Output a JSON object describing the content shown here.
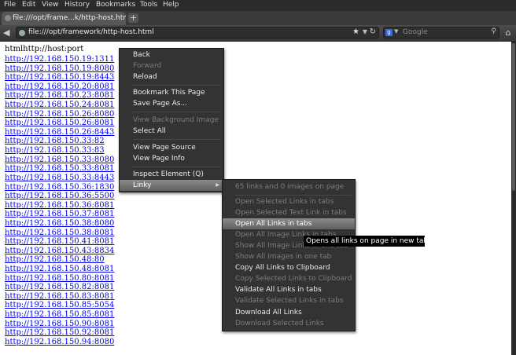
{
  "menubar": [
    "File",
    "Edit",
    "View",
    "History",
    "Bookmarks",
    "Tools",
    "Help"
  ],
  "tab": {
    "title": "file:///opt/frame...k/http-host.html",
    "new_tab": "+"
  },
  "nav": {
    "url": "file:///opt/framework/http-host.html",
    "search_placeholder": "Google",
    "star": "★",
    "reload": "↻",
    "back": "◀",
    "home": "⌂",
    "search_icon": "⚲",
    "google": "g"
  },
  "page": {
    "heading": "htmlhttp://host:port",
    "links": [
      "http://192.168.150.19:1311",
      "http://192.168.150.19:8080",
      "http://192.168.150.19:8443",
      "http://192.168.150.20:8081",
      "http://192.168.150.23:8081",
      "http://192.168.150.24:8081",
      "http://192.168.150.26:8080",
      "http://192.168.150.26:8081",
      "http://192.168.150.26:8443",
      "http://192.168.150.33:82",
      "http://192.168.150.33:83",
      "http://192.168.150.33:8080",
      "http://192.168.150.33:8081",
      "http://192.168.150.33:8443",
      "http://192.168.150.36:1830",
      "http://192.168.150.36:5500",
      "http://192.168.150.36:8081",
      "http://192.168.150.37:8081",
      "http://192.168.150.38:8080",
      "http://192.168.150.38:8081",
      "http://192.168.150.41:8081",
      "http://192.168.150.43:8834",
      "http://192.168.150.48:80",
      "http://192.168.150.48:8081",
      "http://192.168.150.80:8081",
      "http://192.168.150.82:8081",
      "http://192.168.150.83:8081",
      "http://192.168.150.85:5054",
      "http://192.168.150.85:8081",
      "http://192.168.150.90:8081",
      "http://192.168.150.92:8081",
      "http://192.168.150.94:8080"
    ]
  },
  "context_menu": {
    "back": "Back",
    "forward": "Forward",
    "reload": "Reload",
    "bookmark": "Bookmark This Page",
    "save": "Save Page As...",
    "view_bg": "View Background Image",
    "select_all": "Select All",
    "view_source": "View Page Source",
    "view_info": "View Page Info",
    "inspect": "Inspect Element (Q)",
    "linky": "Linky",
    "arrow": "▶"
  },
  "submenu": {
    "summary": "65 links and 0 images on page",
    "open_selected": "Open Selected Links in tabs",
    "open_selected_text": "Open Selected Text Link in tabs",
    "open_all": "Open All Links in tabs",
    "open_all_images": "Open All Image Links in tabs",
    "show_all_image_links": "Show All Image Links in one tab",
    "show_all_images": "Show All Images in one tab",
    "copy_all": "Copy All Links to Clipboard",
    "copy_selected": "Copy Selected Links to Clipboard",
    "validate_all": "Validate All Links in tabs",
    "validate_selected": "Validate Selected Links in tabs",
    "download_all": "Download All Links",
    "download_selected": "Download Selected Links"
  },
  "tooltip": "Opens all links on page in new tabs"
}
